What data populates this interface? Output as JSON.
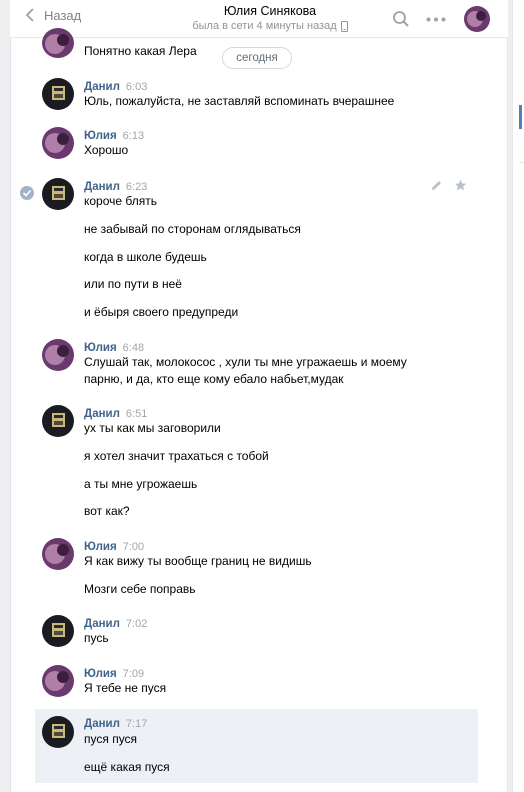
{
  "header": {
    "back_label": "Назад",
    "peer_name": "Юлия Синякова",
    "peer_status": "была в сети 4 минуты назад"
  },
  "date_separator": "сегодня",
  "top_partial": {
    "text": "Понятно какая Лера"
  },
  "messages": [
    {
      "author": "Данил",
      "time": "6:03",
      "lines": [
        "Юль, пожалуйста, не заставляй вспоминать вчерашнее"
      ]
    },
    {
      "author": "Юлия",
      "time": "6:13",
      "lines": [
        "Хорошо"
      ]
    },
    {
      "author": "Данил",
      "time": "6:23",
      "lines": [
        "короче блять",
        "не забывай по сторонам оглядываться",
        "когда в школе будешь",
        "или по пути в неё",
        "и ёбыря своего предупреди"
      ]
    },
    {
      "author": "Юлия",
      "time": "6:48",
      "lines": [
        "Слушай так, молокосос , хули ты мне угражаешь и моему",
        "парню, и да, кто еще кому ебало набьет,мудак"
      ]
    },
    {
      "author": "Данил",
      "time": "6:51",
      "lines": [
        "ух ты как мы заговорили",
        "я хотел значит трахаться с тобой",
        "а ты мне угрожаешь",
        "вот как?"
      ]
    },
    {
      "author": "Юлия",
      "time": "7:00",
      "lines": [
        "Я как вижу ты вообще границ не видишь",
        "Мозги себе поправь"
      ]
    },
    {
      "author": "Данил",
      "time": "7:02",
      "lines": [
        "пусь"
      ]
    },
    {
      "author": "Юлия",
      "time": "7:09",
      "lines": [
        "Я тебе не пуся"
      ]
    },
    {
      "author": "Данил",
      "time": "7:17",
      "lines": [
        "пуся пуся",
        "ещё какая пуся"
      ]
    }
  ],
  "colors": {
    "accent": "#5181b8",
    "author": "#42648b",
    "selected_bg": "#edf0f5"
  }
}
